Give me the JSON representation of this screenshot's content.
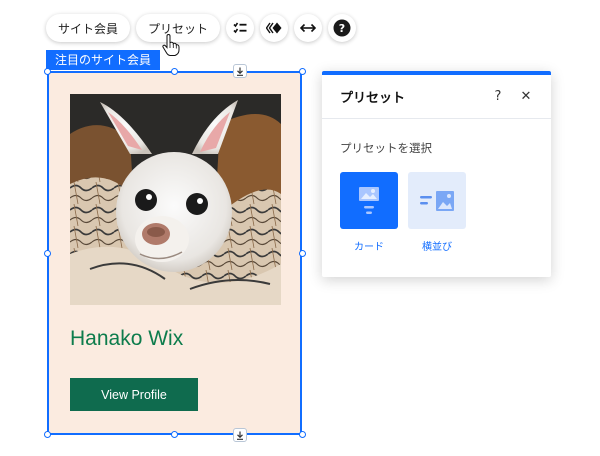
{
  "toolbar": {
    "members_label": "サイト会員",
    "presets_label": "プリセット"
  },
  "selection": {
    "tag_label": "注目のサイト会員"
  },
  "card": {
    "member_name": "Hanako Wix",
    "button_label": "View Profile"
  },
  "panel": {
    "title": "プリセット",
    "help_label": "?",
    "close_label": "✕",
    "subtitle": "プリセットを選択",
    "options": [
      {
        "label": "カード"
      },
      {
        "label": "横並び"
      }
    ]
  },
  "colors": {
    "accent": "#116dff",
    "card_bg": "#fbebe0",
    "name_text": "#0d7c4c",
    "button_bg": "#0f6b4e"
  }
}
